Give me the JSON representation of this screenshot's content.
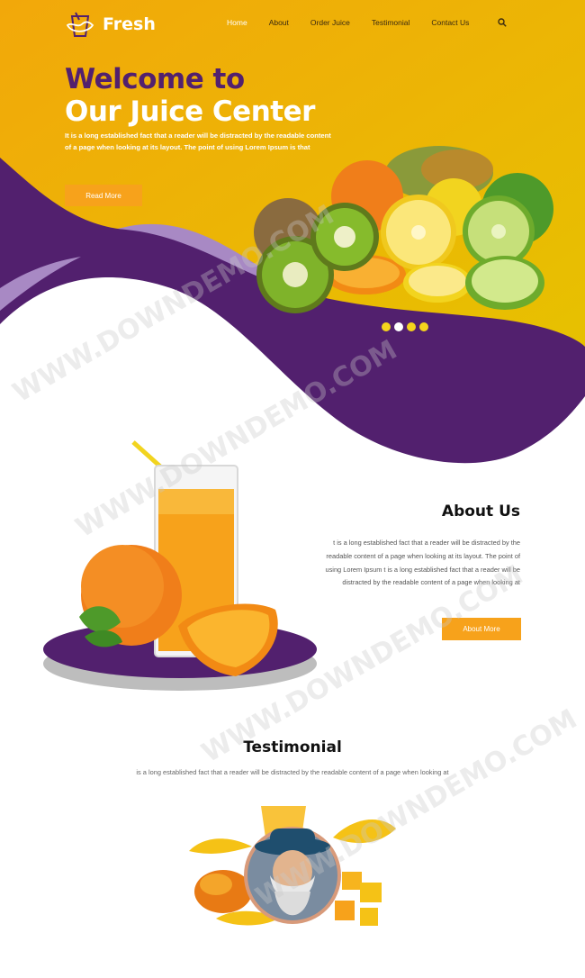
{
  "brand": {
    "name": "Fresh"
  },
  "nav": {
    "items": [
      {
        "label": "Home",
        "active": true
      },
      {
        "label": "About",
        "active": false
      },
      {
        "label": "Order Juice",
        "active": false
      },
      {
        "label": "Testimonial",
        "active": false
      },
      {
        "label": "Contact Us",
        "active": false
      }
    ],
    "search_icon": "search-icon"
  },
  "hero": {
    "title_line1": "Welcome to",
    "title_line2": "Our Juice Center",
    "description": "It is a long established fact that a reader will be distracted by the readable content of a page when looking at its layout. The point of using Lorem Ipsum is that",
    "button_label": "Read More",
    "slider_dots": 4,
    "active_dot": 1
  },
  "about": {
    "title": "About Us",
    "text": "t is a long established fact that a reader will be distracted by the readable content of a page when looking at its layout. The point of using Lorem Ipsum t is a long established fact that a reader will be distracted by the readable content of a page when looking at",
    "button_label": "About More"
  },
  "testimonial": {
    "title": "Testimonial",
    "text": "is a long established fact that a reader will be distracted by the readable content of a page when looking at"
  },
  "watermark": "WWW.DOWNDEMO.COM",
  "colors": {
    "yellow": "#f0b400",
    "purple": "#52206e",
    "orange_button": "#f7a21b",
    "dot_yellow": "#f5d41c"
  }
}
